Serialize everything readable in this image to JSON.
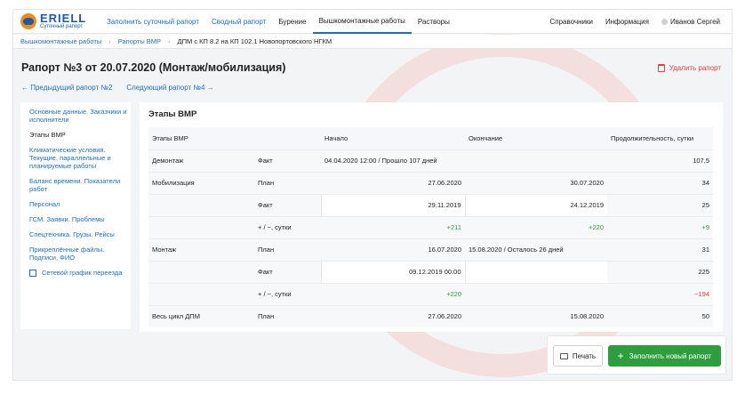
{
  "brand": {
    "name": "ERIELL",
    "subtitle": "Суточный рапорт"
  },
  "nav": {
    "items": [
      {
        "label": "Заполнить суточный рапорт"
      },
      {
        "label": "Сводный рапорт"
      },
      {
        "label": "Бурение"
      },
      {
        "label": "Вышкомонтажные работы"
      },
      {
        "label": "Растворы"
      }
    ],
    "right": [
      {
        "label": "Справочники"
      },
      {
        "label": "Информация"
      }
    ],
    "user": "Иванов Сергей"
  },
  "breadcrumb": {
    "items": [
      "Вышкомонтажные работы",
      "Рапорты ВМР",
      "ДПМ с КП 8.2 на КП 102.1 Новопортовского НГКМ"
    ]
  },
  "header": {
    "title": "Рапорт №3 от 20.07.2020 (Монтаж/мобилизация)",
    "delete_label": "Удалить рапорт",
    "prev_label": "← Предыдущий рапорт №2",
    "next_label": "Следующий рапорт №4 →"
  },
  "side_menu": [
    {
      "label": "Основные данные. Заказчики и исполнители"
    },
    {
      "label": "Этапы ВМР"
    },
    {
      "label": "Климатические условия. Текущие, параллельные и планируемые работы"
    },
    {
      "label": "Баланс времени. Показатели работ"
    },
    {
      "label": "Персонал"
    },
    {
      "label": "ГСМ. Заявки. Проблемы"
    },
    {
      "label": "Спецтехника. Грузы. Рейсы"
    },
    {
      "label": "Прикреплённые файлы. Подписи, ФИО"
    },
    {
      "label": "Сетевой график переезда"
    }
  ],
  "section": {
    "title": "Этапы ВМР",
    "columns": [
      "Этапы ВМР",
      "Начало",
      "Окончание",
      "Продолжительность, сутки"
    ],
    "rows": [
      {
        "stage": "Демонтаж",
        "type": "Факт",
        "start": "04.04.2020 12:00 / Прошло 107 дней",
        "end": "",
        "duration": "107,5"
      },
      {
        "stage": "Мобилизация",
        "type": "План",
        "start": "27.06.2020",
        "end": "30.07.2020",
        "duration": "34"
      },
      {
        "stage": "",
        "type": "Факт",
        "start": "29.11.2019",
        "end": "24.12.2019",
        "duration": "25"
      },
      {
        "stage": "",
        "type": "+ / −, сутки",
        "start": "+211",
        "end": "+220",
        "duration": "+9"
      },
      {
        "stage": "Монтаж",
        "type": "План",
        "start": "16.07.2020",
        "end": "15.08.2020 / Осталось 26 дней",
        "duration": "31"
      },
      {
        "stage": "",
        "type": "Факт",
        "start": "09.12.2019 00:00",
        "end": "",
        "duration": "225"
      },
      {
        "stage": "",
        "type": "+ / −, сутки",
        "start": "+220",
        "end": "",
        "duration": "−194"
      },
      {
        "stage": "Весь цикл ДПМ",
        "type": "План",
        "start": "27.06.2020",
        "end": "15.08.2020",
        "duration": "50"
      }
    ]
  },
  "footer": {
    "print_label": "Печать",
    "fill_label": "Заполнить новый рапорт"
  },
  "colors": {
    "accent": "#1e6ec8",
    "positive": "#2e9d3e",
    "negative": "#e03c3c",
    "danger": "#e04040"
  }
}
